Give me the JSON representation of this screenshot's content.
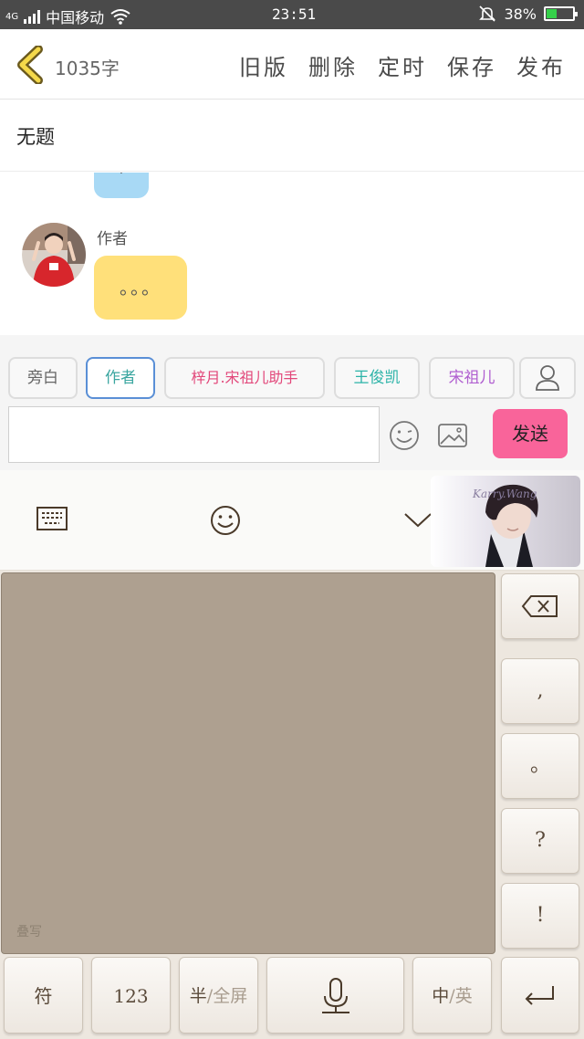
{
  "status_bar": {
    "network": "4G",
    "carrier": "中国移动",
    "time": "23:51",
    "battery": "38%",
    "battery_level": 0.38
  },
  "nav": {
    "word_count": "1035字",
    "buttons": [
      "旧版",
      "删除",
      "定时",
      "保存",
      "发布"
    ]
  },
  "title": "无题",
  "chat": {
    "previous_bubble_color": "#a8d9f5",
    "author_name": "作者",
    "message_text": "。。。",
    "message_bubble_color": "#ffe07a"
  },
  "roles": [
    {
      "label": "旁白",
      "color": "#666666",
      "active": false
    },
    {
      "label": "作者",
      "color": "#3aa6a0",
      "active": true
    },
    {
      "label": "梓月.宋祖儿助手",
      "color": "#e2477a",
      "active": false
    },
    {
      "label": "王俊凯",
      "color": "#2cb3a8",
      "active": false
    },
    {
      "label": "宋祖儿",
      "color": "#b05fd0",
      "active": false
    }
  ],
  "composer": {
    "input_value": "",
    "send_label": "发送",
    "send_color": "#f9649a"
  },
  "keyboard": {
    "skin_text": "Karry.Wang",
    "handwriting_label": "叠写",
    "side_keys": [
      ",",
      "。",
      "?",
      "!"
    ],
    "bottom_keys": {
      "symbols": "符",
      "numbers": "123",
      "half": "半",
      "slash": "/",
      "full": "全屏",
      "zh": "中",
      "en": "英"
    }
  }
}
